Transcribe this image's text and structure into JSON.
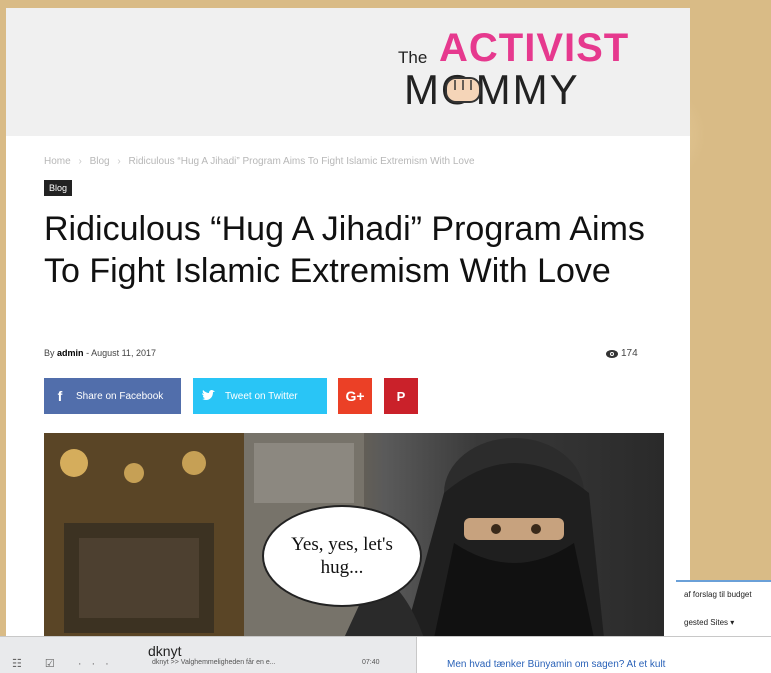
{
  "logo": {
    "the": "The",
    "activist": "ACTIVIST",
    "mommy": "MOMMY"
  },
  "breadcrumb": {
    "home": "Home",
    "sep": "›",
    "blog": "Blog",
    "current": "Ridiculous “Hug A Jihadi” Program Aims To Fight Islamic Extremism With Love"
  },
  "article": {
    "category": "Blog",
    "title": "Ridiculous “Hug A Jihadi” Program Aims To Fight Islamic Extremism With Love",
    "by": "By",
    "author": "admin",
    "dash": "-",
    "date": "August 11, 2017",
    "views": "174",
    "bubble_line1": "Yes, yes, let's",
    "bubble_line2": "hug..."
  },
  "share": {
    "facebook": "Share on Facebook",
    "twitter": "Tweet on Twitter",
    "google_plus": "G+",
    "pinterest": "P"
  },
  "taskbar": {
    "icons": "☷ ☑ ···",
    "app_title": "dknyt",
    "preview": "dknyt >> Valghemmeligheden får en e...",
    "time": "07:40",
    "message": "Men hvad tænker Bünyamin om sagen? At et kult"
  },
  "side_panel": {
    "line1": "af forslag til budget",
    "line2": "gested Sites ▾"
  },
  "colors": {
    "accent_pink": "#e6398e",
    "facebook": "#516eab",
    "twitter": "#29c5f6",
    "google_plus": "#eb4026",
    "pinterest": "#ca212a"
  }
}
